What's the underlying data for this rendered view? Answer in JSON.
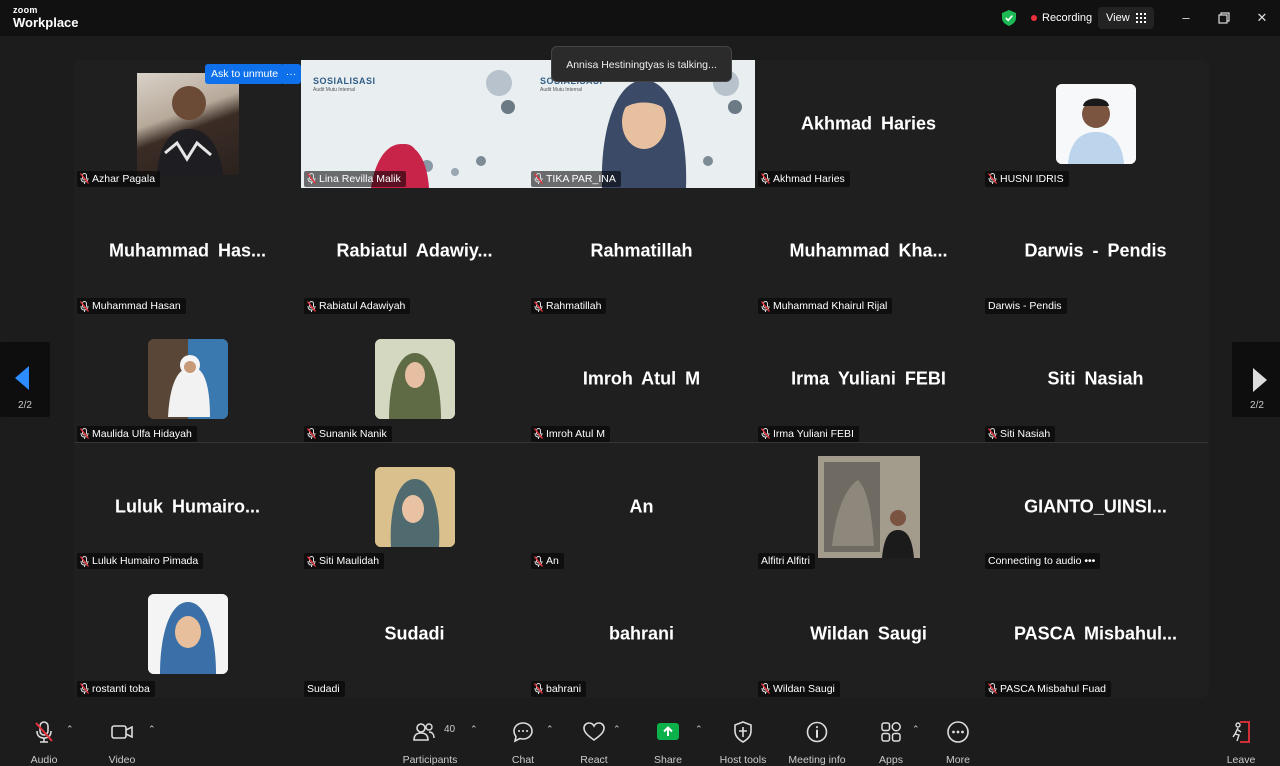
{
  "titlebar": {
    "logo_top": "zoom",
    "logo_bottom": "Workplace",
    "recording_label": "Recording",
    "view_label": "View"
  },
  "toast": "Annisa Hestiningtyas is talking...",
  "ask_to_unmute": "Ask to unmute",
  "more_dots": "···",
  "slide": {
    "title": "SOSIALISASI",
    "subtitle": "Audit Mutu Internal"
  },
  "page_indicator": "2/2",
  "tiles": [
    {
      "big": "",
      "label": "Azhar Pagala",
      "muted": true
    },
    {
      "big": "",
      "label": "Lina Revilla Malik",
      "muted": true
    },
    {
      "big": "",
      "label": "TIKA PAR_INA",
      "muted": true
    },
    {
      "big": "Akhmad Haries",
      "label": "Akhmad Haries",
      "muted": true
    },
    {
      "big": "",
      "label": "HUSNI IDRIS",
      "muted": true
    },
    {
      "big": "Muhammad  Has...",
      "label": "Muhammad Hasan",
      "muted": true
    },
    {
      "big": "Rabiatul  Adawiy...",
      "label": "Rabiatul Adawiyah",
      "muted": true
    },
    {
      "big": "Rahmatillah",
      "label": "Rahmatillah",
      "muted": true
    },
    {
      "big": "Muhammad  Kha...",
      "label": "Muhammad Khairul Rijal",
      "muted": true
    },
    {
      "big": "Darwis - Pendis",
      "label": "Darwis - Pendis",
      "muted": false
    },
    {
      "big": "",
      "label": "Maulida Ulfa Hidayah",
      "muted": true
    },
    {
      "big": "",
      "label": "Sunanik Nanik",
      "muted": true
    },
    {
      "big": "Imroh Atul M",
      "label": "Imroh Atul M",
      "muted": true
    },
    {
      "big": "Irma Yuliani FEBI",
      "label": "Irma Yuliani FEBI",
      "muted": true
    },
    {
      "big": "Siti Nasiah",
      "label": "Siti Nasiah",
      "muted": true
    },
    {
      "big": "Luluk  Humairo...",
      "label": "Luluk Humairo Pimada",
      "muted": true
    },
    {
      "big": "",
      "label": "Siti Maulidah",
      "muted": true
    },
    {
      "big": "An",
      "label": "An",
      "muted": true
    },
    {
      "big": "",
      "label": "Alfitri Alfitri",
      "muted": false
    },
    {
      "big": "GIANTO_UINSI...",
      "label": "Connecting to audio •••",
      "muted": false
    },
    {
      "big": "",
      "label": "rostanti toba",
      "muted": true
    },
    {
      "big": "Sudadi",
      "label": "Sudadi",
      "muted": false
    },
    {
      "big": "bahrani",
      "label": "bahrani",
      "muted": true
    },
    {
      "big": "Wildan Saugi",
      "label": "Wildan Saugi",
      "muted": true
    },
    {
      "big": "PASCA  Misbahul...",
      "label": "PASCA Misbahul Fuad",
      "muted": true
    }
  ],
  "toolbar": {
    "audio": "Audio",
    "video": "Video",
    "participants": "Participants",
    "participants_count": "40",
    "chat": "Chat",
    "react": "React",
    "share": "Share",
    "host_tools": "Host tools",
    "meeting_info": "Meeting info",
    "apps": "Apps",
    "more": "More",
    "leave": "Leave"
  },
  "colors": {
    "share_green": "#0db14b",
    "mute_red": "#e8313b",
    "unmute_blue": "#0e71eb",
    "nav_arrow_blue": "#2d8cff",
    "shield_green": "#1db954"
  }
}
